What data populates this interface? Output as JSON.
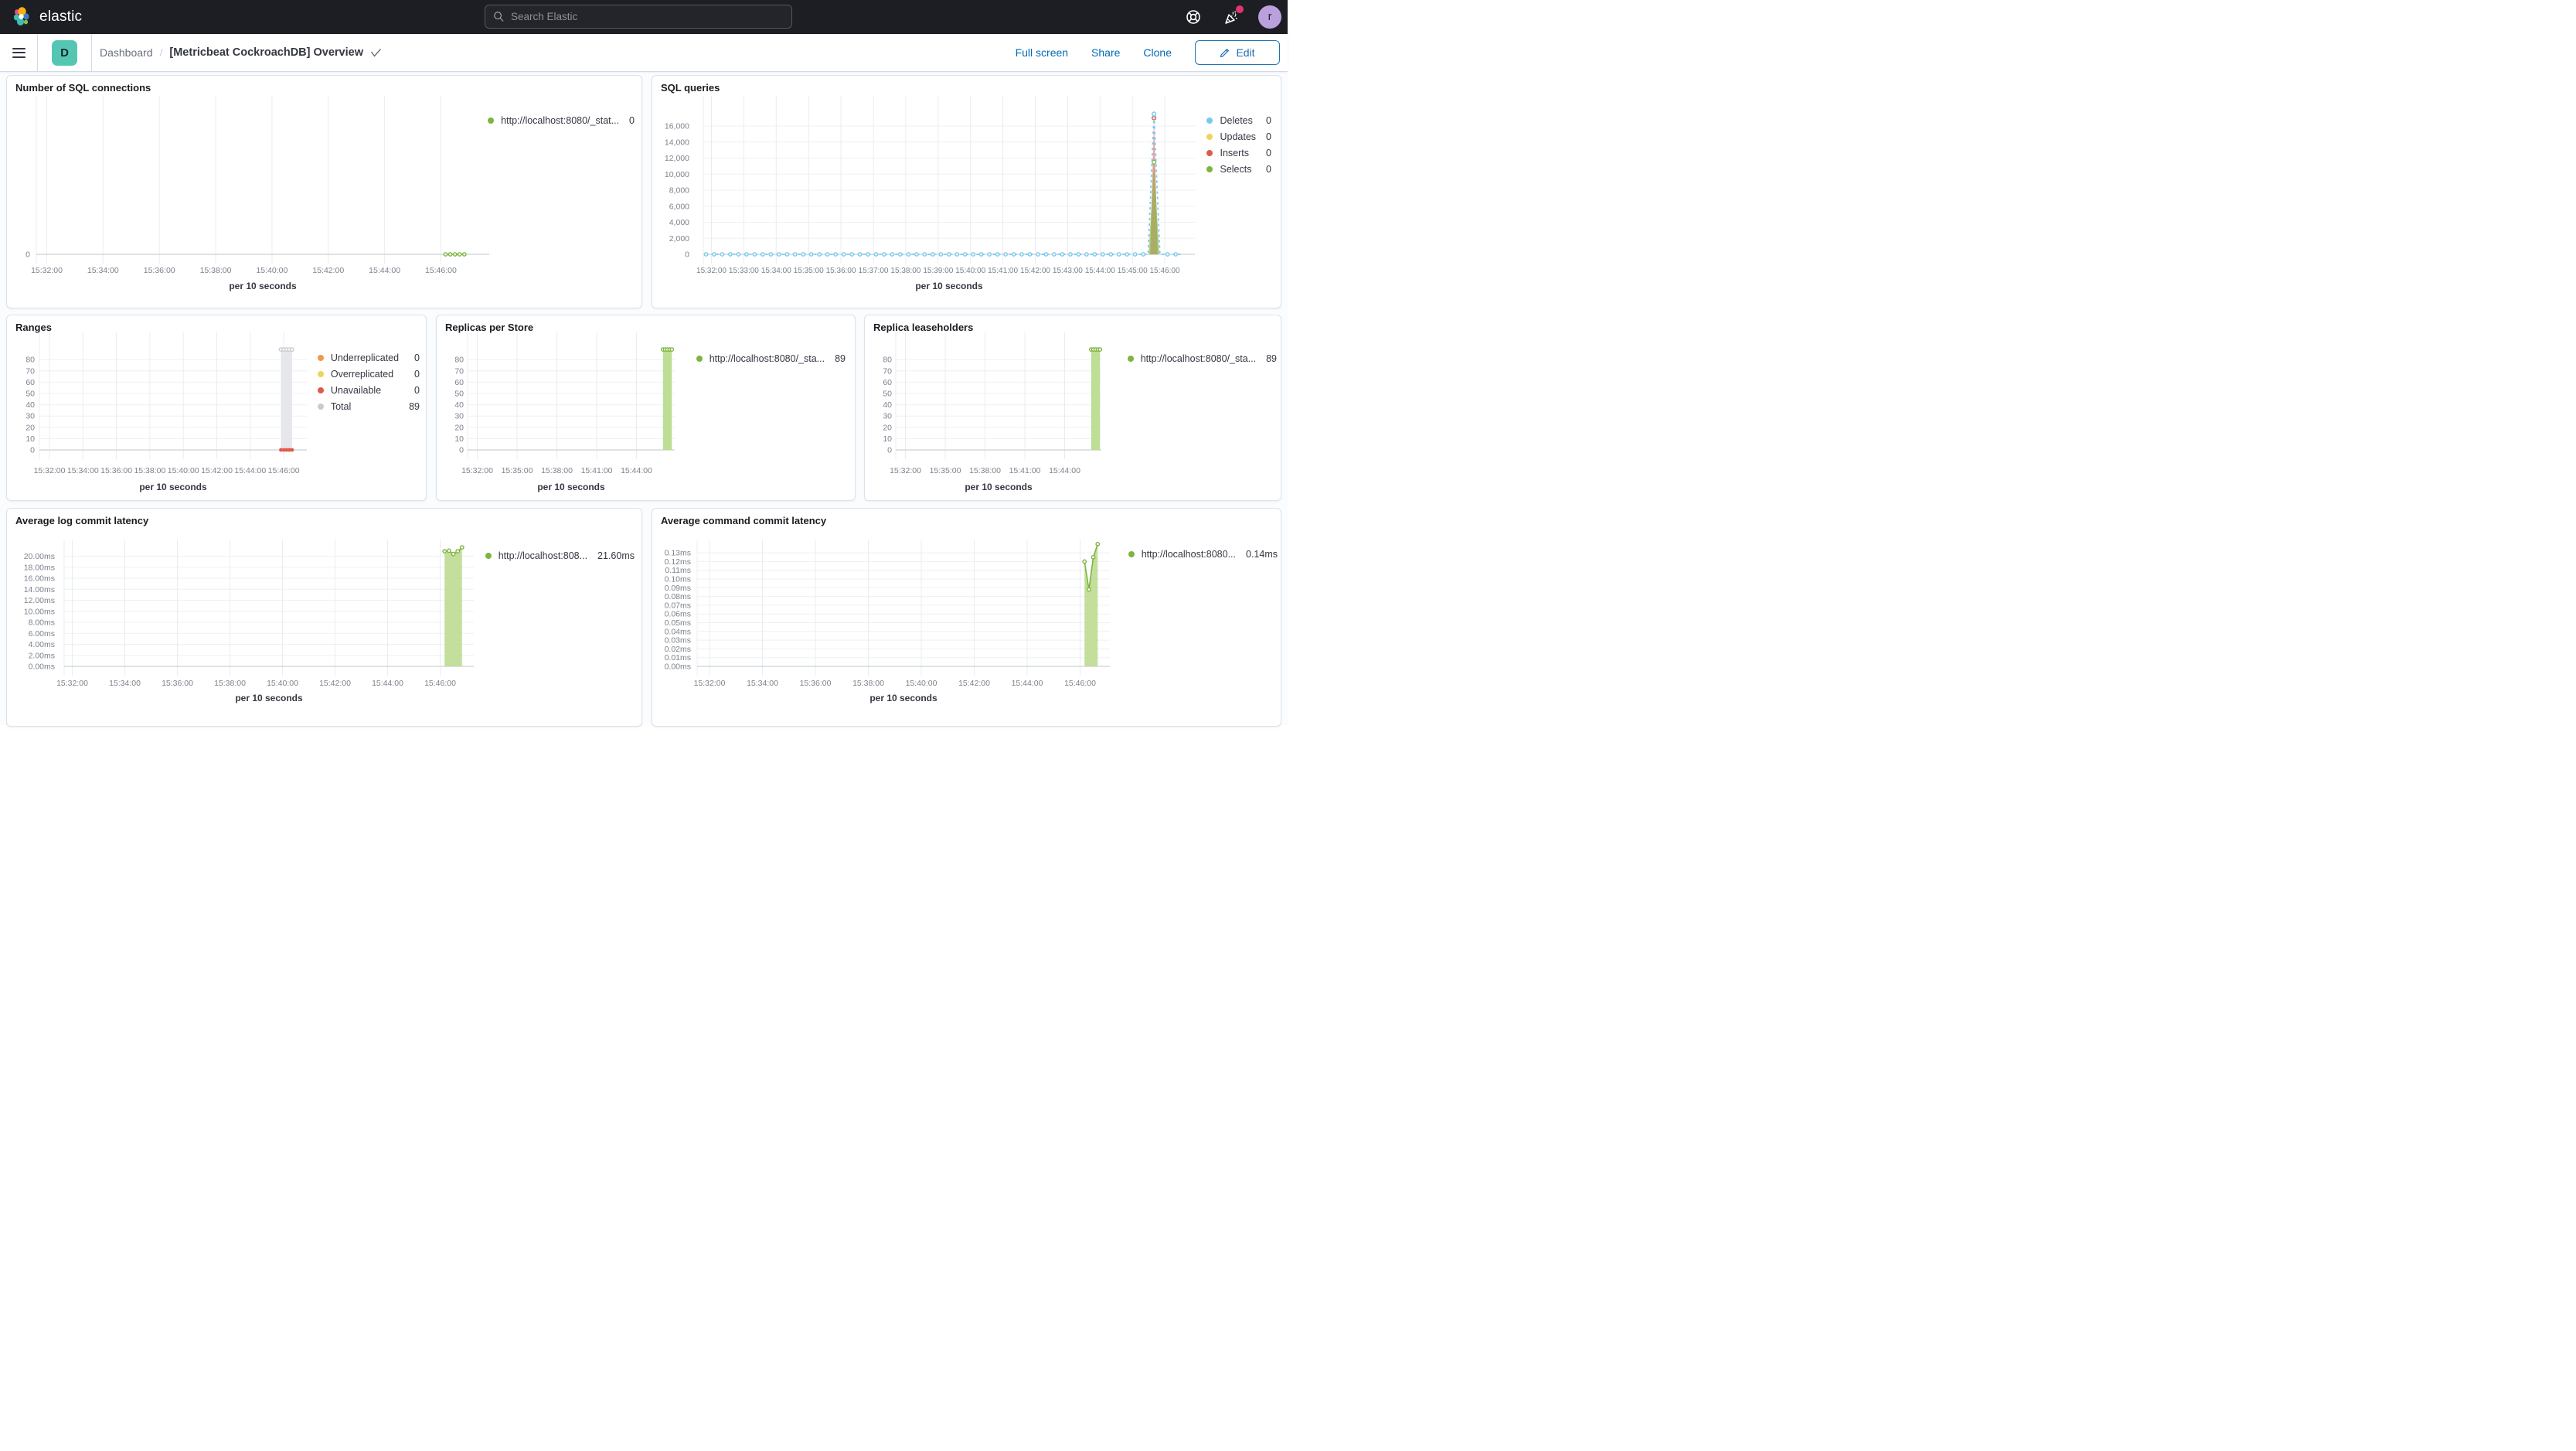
{
  "colors": {
    "header_bg": "#1D1E24",
    "accent_blue": "#006BB4",
    "badge_teal": "#55C6B2",
    "green": "#7EB440",
    "blue": "#79C9EC",
    "yellow": "#EFD35C",
    "red": "#E0594B",
    "orange": "#F0984A",
    "gray": "#C9CBD1",
    "notification_pink": "#E6326E",
    "avatar_purple": "#BBA0DE"
  },
  "header": {
    "brand": "elastic",
    "search": {
      "placeholder": "Search Elastic"
    },
    "icons": [
      "help-icon",
      "news-icon",
      "user-avatar"
    ],
    "avatar_initial": "r"
  },
  "toolbar": {
    "app_badge": "D",
    "breadcrumb": [
      "Dashboard"
    ],
    "separator": "/",
    "title": "[Metricbeat CockroachDB] Overview",
    "actions": [
      "Full screen",
      "Share",
      "Clone"
    ],
    "edit_label": "Edit"
  },
  "panels": [
    {
      "id": "sql_connections",
      "title": "Number of SQL connections",
      "legend": [
        {
          "label": "http://localhost:8080/_stat...",
          "value": "0",
          "color": "#7EB440"
        }
      ],
      "chart_data": {
        "type": "line",
        "title": "Number of SQL connections",
        "xlabel": "per 10 seconds",
        "x_ticks": [
          "15:32:00",
          "15:34:00",
          "15:36:00",
          "15:38:00",
          "15:40:00",
          "15:42:00",
          "15:44:00",
          "15:46:00"
        ],
        "y_ticks": [
          "0"
        ],
        "y_tick_step": 1,
        "ylim": [
          0,
          1
        ],
        "grid": true,
        "legend_position": "right",
        "series": [
          {
            "name": "http://localhost:8080/_stat...",
            "color": "#7EB440",
            "latest": 0,
            "points": [
              [
                "15:46:10",
                0
              ],
              [
                "15:46:20",
                0
              ],
              [
                "15:46:30",
                0
              ],
              [
                "15:46:40",
                0
              ],
              [
                "15:46:50",
                0
              ]
            ]
          }
        ]
      }
    },
    {
      "id": "sql_queries",
      "title": "SQL queries",
      "legend": [
        {
          "label": "Deletes",
          "value": "0",
          "color": "#79C9EC"
        },
        {
          "label": "Updates",
          "value": "0",
          "color": "#EFD35C"
        },
        {
          "label": "Inserts",
          "value": "0",
          "color": "#E0594B"
        },
        {
          "label": "Selects",
          "value": "0",
          "color": "#7EB440"
        }
      ],
      "chart_data": {
        "type": "area",
        "title": "SQL queries",
        "xlabel": "per 10 seconds",
        "x_ticks": [
          "15:32:00",
          "15:33:00",
          "15:34:00",
          "15:35:00",
          "15:36:00",
          "15:37:00",
          "15:38:00",
          "15:39:00",
          "15:40:00",
          "15:41:00",
          "15:42:00",
          "15:43:00",
          "15:44:00",
          "15:45:00",
          "15:46:00"
        ],
        "y_ticks": [
          "0",
          "2,000",
          "4,000",
          "6,000",
          "8,000",
          "10,000",
          "12,000",
          "14,000",
          "16,000"
        ],
        "y_tick_step": 2000,
        "ylim": [
          0,
          16000
        ],
        "grid": true,
        "legend_position": "right",
        "series": [
          {
            "name": "Deletes",
            "color": "#79C9EC",
            "latest": 0,
            "points": [
              [
                "15:31:50",
                0
              ],
              [
                "15:45:29",
                0
              ],
              [
                "15:45:40",
                17500
              ],
              [
                "15:45:51",
                0
              ],
              [
                "15:46:30",
                0
              ]
            ]
          },
          {
            "name": "Updates",
            "color": "#EFD35C",
            "latest": 0,
            "points": [
              [
                "15:31:50",
                0
              ],
              [
                "15:46:30",
                0
              ]
            ]
          },
          {
            "name": "Inserts",
            "color": "#E0594B",
            "latest": 0,
            "points": [
              [
                "15:45:33",
                0
              ],
              [
                "15:45:40",
                17000
              ],
              [
                "15:45:47",
                0
              ]
            ]
          },
          {
            "name": "Selects",
            "color": "#7EB440",
            "latest": 0,
            "points": [
              [
                "15:45:30",
                0
              ],
              [
                "15:45:40",
                11500
              ],
              [
                "15:45:50",
                0
              ]
            ]
          }
        ]
      }
    },
    {
      "id": "ranges",
      "title": "Ranges",
      "legend": [
        {
          "label": "Underreplicated",
          "value": "0",
          "color": "#F0984A"
        },
        {
          "label": "Overreplicated",
          "value": "0",
          "color": "#EFD35C"
        },
        {
          "label": "Unavailable",
          "value": "0",
          "color": "#E0594B"
        },
        {
          "label": "Total",
          "value": "89",
          "color": "#C9CBD1"
        }
      ],
      "chart_data": {
        "type": "area",
        "title": "Ranges",
        "xlabel": "per 10 seconds",
        "x_ticks": [
          "15:32:00",
          "15:34:00",
          "15:36:00",
          "15:38:00",
          "15:40:00",
          "15:42:00",
          "15:44:00",
          "15:46:00"
        ],
        "y_ticks": [
          "0",
          "10",
          "20",
          "30",
          "40",
          "50",
          "60",
          "70",
          "80"
        ],
        "y_tick_step": 10,
        "ylim": [
          0,
          80
        ],
        "grid": true,
        "legend_position": "right",
        "series": [
          {
            "name": "Underreplicated",
            "color": "#F0984A",
            "latest": 0,
            "points": [
              [
                "15:45:50",
                0
              ],
              [
                "15:46:30",
                0
              ]
            ]
          },
          {
            "name": "Overreplicated",
            "color": "#EFD35C",
            "latest": 0,
            "points": [
              [
                "15:45:50",
                0
              ],
              [
                "15:46:30",
                0
              ]
            ]
          },
          {
            "name": "Unavailable",
            "color": "#E0594B",
            "latest": 0,
            "points": [
              [
                "15:45:50",
                0
              ],
              [
                "15:46:00",
                0
              ],
              [
                "15:46:10",
                0
              ],
              [
                "15:46:20",
                0
              ],
              [
                "15:46:30",
                0
              ]
            ]
          },
          {
            "name": "Total",
            "color": "#C9CBD1",
            "latest": 89,
            "points": [
              [
                "15:45:50",
                89
              ],
              [
                "15:46:00",
                89
              ],
              [
                "15:46:10",
                89
              ],
              [
                "15:46:20",
                89
              ],
              [
                "15:46:30",
                89
              ]
            ]
          }
        ]
      }
    },
    {
      "id": "replicas_per_store",
      "title": "Replicas per Store",
      "legend": [
        {
          "label": "http://localhost:8080/_sta...",
          "value": "89",
          "color": "#7EB440"
        }
      ],
      "chart_data": {
        "type": "area",
        "title": "Replicas per Store",
        "xlabel": "per 10 seconds",
        "x_ticks": [
          "15:32:00",
          "15:35:00",
          "15:38:00",
          "15:41:00",
          "15:44:00"
        ],
        "y_ticks": [
          "0",
          "10",
          "20",
          "30",
          "40",
          "50",
          "60",
          "70",
          "80"
        ],
        "y_tick_step": 10,
        "ylim": [
          0,
          80
        ],
        "grid": true,
        "legend_position": "right",
        "series": [
          {
            "name": "http://localhost:8080/_sta...",
            "color": "#7EB440",
            "latest": 89,
            "points": [
              [
                "15:46:00",
                89
              ],
              [
                "15:46:10",
                89
              ],
              [
                "15:46:20",
                89
              ],
              [
                "15:46:30",
                89
              ],
              [
                "15:46:40",
                89
              ]
            ]
          }
        ]
      }
    },
    {
      "id": "replica_leaseholders",
      "title": "Replica leaseholders",
      "legend": [
        {
          "label": "http://localhost:8080/_sta...",
          "value": "89",
          "color": "#7EB440"
        }
      ],
      "chart_data": {
        "type": "area",
        "title": "Replica leaseholders",
        "xlabel": "per 10 seconds",
        "x_ticks": [
          "15:32:00",
          "15:35:00",
          "15:38:00",
          "15:41:00",
          "15:44:00"
        ],
        "y_ticks": [
          "0",
          "10",
          "20",
          "30",
          "40",
          "50",
          "60",
          "70",
          "80"
        ],
        "y_tick_step": 10,
        "ylim": [
          0,
          80
        ],
        "grid": true,
        "legend_position": "right",
        "series": [
          {
            "name": "http://localhost:8080/_sta...",
            "color": "#7EB440",
            "latest": 89,
            "points": [
              [
                "15:46:00",
                89
              ],
              [
                "15:46:10",
                89
              ],
              [
                "15:46:20",
                89
              ],
              [
                "15:46:30",
                89
              ],
              [
                "15:46:40",
                89
              ]
            ]
          }
        ]
      }
    },
    {
      "id": "avg_log_commit_latency",
      "title": "Average log commit latency",
      "legend": [
        {
          "label": "http://localhost:808...",
          "value": "21.60ms",
          "color": "#7EB440"
        }
      ],
      "chart_data": {
        "type": "area",
        "title": "Average log commit latency",
        "xlabel": "per 10 seconds",
        "x_ticks": [
          "15:32:00",
          "15:34:00",
          "15:36:00",
          "15:38:00",
          "15:40:00",
          "15:42:00",
          "15:44:00",
          "15:46:00"
        ],
        "y_ticks": [
          "0.00ms",
          "2.00ms",
          "4.00ms",
          "6.00ms",
          "8.00ms",
          "10.00ms",
          "12.00ms",
          "14.00ms",
          "16.00ms",
          "18.00ms",
          "20.00ms"
        ],
        "y_tick_step": 2,
        "ylim": [
          0,
          20
        ],
        "grid": true,
        "legend_position": "right",
        "series": [
          {
            "name": "http://localhost:808...",
            "color": "#7EB440",
            "latest": "21.60ms",
            "points": [
              [
                "15:46:10",
                20.9
              ],
              [
                "15:46:20",
                21.0
              ],
              [
                "15:46:30",
                20.4
              ],
              [
                "15:46:40",
                20.9
              ],
              [
                "15:46:50",
                21.6
              ]
            ]
          }
        ]
      }
    },
    {
      "id": "avg_command_commit_latency",
      "title": "Average command commit latency",
      "legend": [
        {
          "label": "http://localhost:8080...",
          "value": "0.14ms",
          "color": "#7EB440"
        }
      ],
      "chart_data": {
        "type": "area",
        "title": "Average command commit latency",
        "xlabel": "per 10 seconds",
        "x_ticks": [
          "15:32:00",
          "15:34:00",
          "15:36:00",
          "15:38:00",
          "15:40:00",
          "15:42:00",
          "15:44:00",
          "15:46:00"
        ],
        "y_ticks": [
          "0.00ms",
          "0.01ms",
          "0.02ms",
          "0.03ms",
          "0.04ms",
          "0.05ms",
          "0.06ms",
          "0.07ms",
          "0.08ms",
          "0.09ms",
          "0.10ms",
          "0.11ms",
          "0.12ms",
          "0.13ms"
        ],
        "y_tick_step": 0.01,
        "ylim": [
          0,
          0.13
        ],
        "grid": true,
        "legend_position": "right",
        "series": [
          {
            "name": "http://localhost:8080...",
            "color": "#7EB440",
            "latest": "0.14ms",
            "points": [
              [
                "15:46:10",
                0.12
              ],
              [
                "15:46:20",
                0.088
              ],
              [
                "15:46:30",
                0.125
              ],
              [
                "15:46:40",
                0.14
              ]
            ]
          }
        ]
      }
    }
  ]
}
